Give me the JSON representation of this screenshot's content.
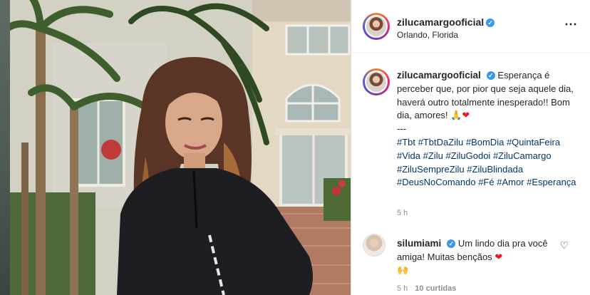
{
  "post": {
    "username": "zilucamargooficial",
    "location": "Orlando, Florida",
    "more_icon": "⋯"
  },
  "caption": {
    "username": "zilucamargooficial",
    "text": "Esperança é perceber que, por pior que seja aquele dia, haverá outro totalmente inesperado!! Bom dia, amores!",
    "emoji_pray": "🙏",
    "emoji_heart": "❤",
    "separator": "---",
    "hashtags": [
      "#Tbt",
      "#TbtDaZilu",
      "#BomDia",
      "#QuintaFeira",
      "#Vida",
      "#Zilu",
      "#ZiluGodoi",
      "#ZiluCamargo",
      "#ZiluSempreZilu",
      "#ZiluBlindada",
      "#DeusNoComando",
      "#Fé",
      "#Amor",
      "#Esperança"
    ],
    "time": "5 h"
  },
  "comment": {
    "username": "silumiami",
    "text": "Um lindo dia pra você amiga! Muitas bençãos",
    "emoji_heart": "❤",
    "emoji_hands": "🙌",
    "time": "5 h",
    "likes": "10 curtidas",
    "like_icon": "♡"
  },
  "backdrop": {
    "close_icon": "✕"
  }
}
